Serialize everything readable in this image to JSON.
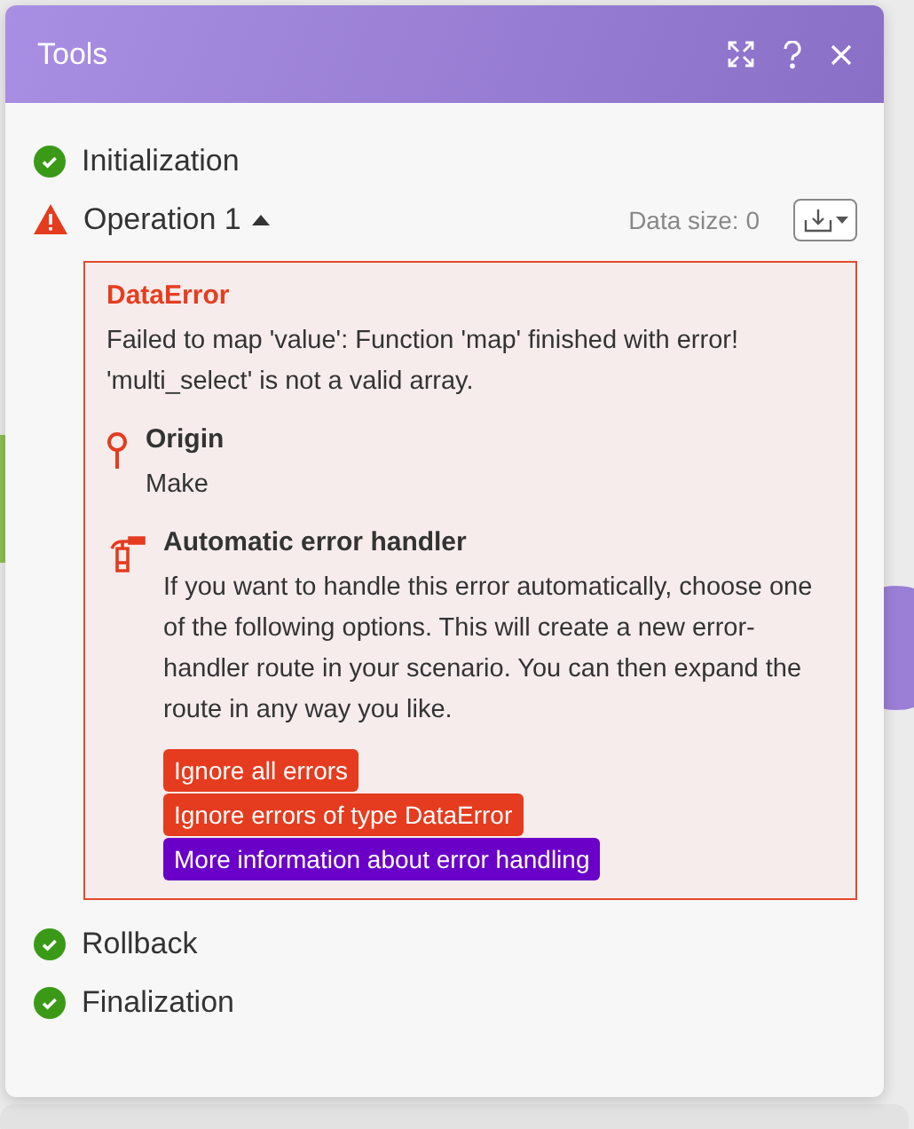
{
  "window": {
    "title": "Tools"
  },
  "steps": [
    {
      "kind": "success",
      "label": "Initialization"
    },
    {
      "kind": "error",
      "label": "Operation 1",
      "expanded": true,
      "data_size": "Data size: 0",
      "error": {
        "title": "DataError",
        "message": "Failed to map 'value': Function 'map' finished with error! 'multi_select' is not a valid array.",
        "origin_label": "Origin",
        "origin_value": "Make",
        "handler_label": "Automatic error handler",
        "handler_text": "If you want to handle this error automatically, choose one of the following options. This will create a new error-handler route in your scenario. You can then expand the route in any way you like.",
        "actions": [
          {
            "kind": "danger",
            "label": "Ignore all errors"
          },
          {
            "kind": "danger",
            "label": "Ignore errors of type DataError"
          },
          {
            "kind": "info",
            "label": "More information about error handling"
          }
        ]
      }
    },
    {
      "kind": "success",
      "label": "Rollback"
    },
    {
      "kind": "success",
      "label": "Finalization"
    }
  ]
}
